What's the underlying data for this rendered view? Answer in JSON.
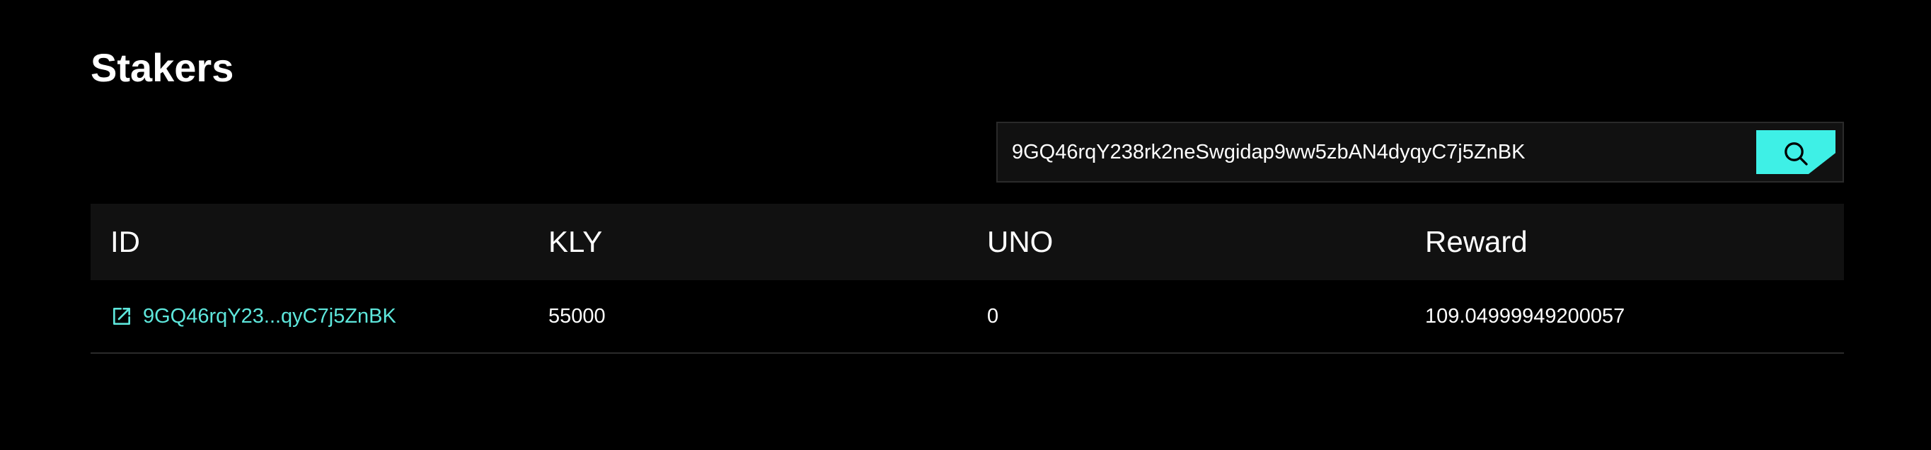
{
  "page": {
    "title": "Stakers"
  },
  "search": {
    "value": "9GQ46rqY238rk2neSwgidap9ww5zbAN4dyqyC7j5ZnBK",
    "icon": "search-icon"
  },
  "table": {
    "headers": [
      "ID",
      "KLY",
      "UNO",
      "Reward"
    ],
    "rows": [
      {
        "id": "9GQ46rqY23...qyC7j5ZnBK",
        "kly": "55000",
        "uno": "0",
        "reward": "109.04999949200057",
        "link_icon": "external-link-icon"
      }
    ]
  },
  "colors": {
    "background": "#000000",
    "accent": "#3ef0e6",
    "link": "#5ee7dc",
    "header_bg": "#111111"
  }
}
